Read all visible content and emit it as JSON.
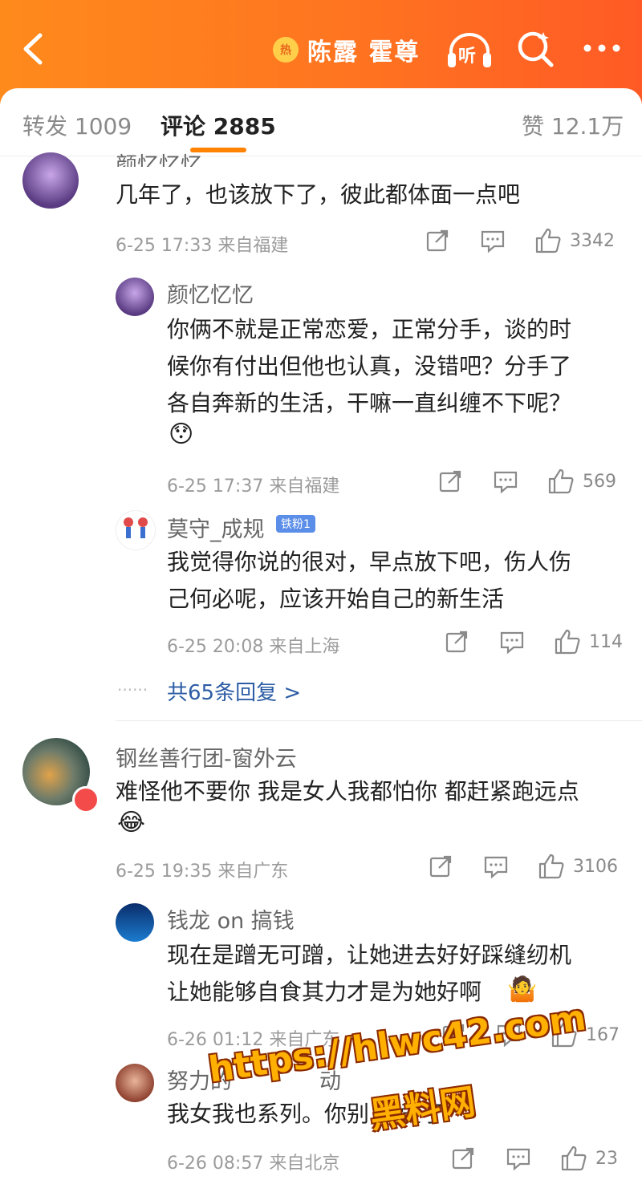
{
  "header": {
    "hot_tag": "热",
    "title": "陈露 霍尊",
    "listen_label": "听"
  },
  "tabs": {
    "repost": "转发 1009",
    "comments": "评论 2885",
    "likes": "赞 12.1万"
  },
  "comments": [
    {
      "name": "颜忆忆忆",
      "text": "几年了，也该放下了，彼此都体面一点吧",
      "meta": "6-25 17:33 来自福建",
      "likes": "3342",
      "replies": [
        {
          "name": "颜忆忆忆",
          "text_lines": [
            "你俩不就是正常恋爱，正常分手，谈的时",
            "候你有付出但他也认真，没错吧？分手了",
            "各自奔新的生活，干嘛一直纠缠不下呢？"
          ],
          "emoji": "😯",
          "meta": "6-25 17:37 来自福建",
          "likes": "569"
        },
        {
          "name": "莫守_成规",
          "badge": "铁粉1",
          "text_lines": [
            "我觉得你说的很对，早点放下吧，伤人伤",
            "己何必呢，应该开始自己的新生活"
          ],
          "meta": "6-25 20:08 来自上海",
          "likes": "114"
        }
      ],
      "more_replies": "共65条回复 >",
      "dots": "······"
    },
    {
      "name": "钢丝善行团-窗外云",
      "text": "难怪他不要你 我是女人我都怕你 都赶紧跑远点",
      "emoji": "😂",
      "meta": "6-25 19:35 来自广东",
      "likes": "3106",
      "replies": [
        {
          "name": "钱龙 on 搞钱",
          "text_lines": [
            "现在是蹭无可蹭，让她进去好好踩缝纫机",
            "让她能够自食其力才是为她好啊"
          ],
          "emoji": "🤷",
          "meta": "6-26 01:12 来自广东",
          "likes": "167"
        },
        {
          "name": "努力的",
          "name_tail": "动",
          "text": "我女我也系列。你别",
          "text_tail": "爱了",
          "meta": "6-26 08:57 来自北京",
          "likes": "23"
        }
      ]
    }
  ],
  "watermark": {
    "url": "https://hlwc42.com",
    "site": "黑料网"
  }
}
